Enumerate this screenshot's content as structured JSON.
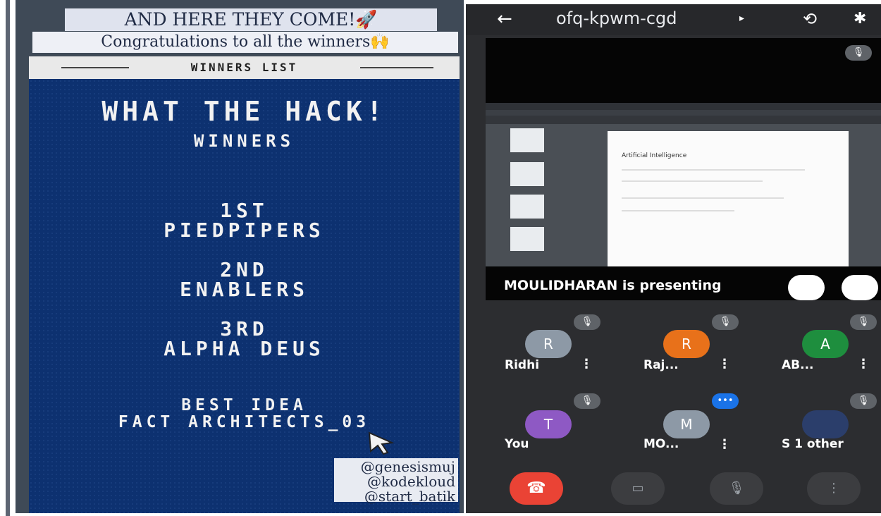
{
  "story": {
    "banner_title": "AND HERE THEY COME!🚀",
    "banner_sub": "Congratulations to all the winners🙌",
    "list_heading": "WINNERS LIST",
    "poster_title": "WHAT THE HACK!",
    "poster_sub": "WINNERS",
    "first_place": "1ST",
    "first_team": "PIEDPIPERS",
    "second_place": "2ND",
    "second_team": "ENABLERS",
    "third_place": "3RD",
    "third_team": "ALPHA DEUS",
    "best_idea": "BEST IDEA",
    "best_idea_team": "FACT ARCHITECTS_03",
    "handles": [
      "@genesismuj",
      "@kodekloud",
      "@start_batik"
    ]
  },
  "meet": {
    "meeting_code": "ofq-kpwm-cgd",
    "doc_title": "Artificial Intelligence",
    "presenting_label": "MOULIDHARAN is presenting",
    "participants": [
      {
        "initial": "R",
        "name": "Ridhi",
        "color": "#8d99a6"
      },
      {
        "initial": "R",
        "name": "Raj...",
        "color": "#e8711a"
      },
      {
        "initial": "A",
        "name": "AB...",
        "color": "#1e8e3e"
      },
      {
        "initial": "T",
        "name": "You",
        "color": "#8e59c4"
      },
      {
        "initial": "M",
        "name": "MO...",
        "color": "#8d99a6"
      },
      {
        "initial": "",
        "name": "S 1 other",
        "color": "#2b3e6b"
      }
    ],
    "icons": [
      "back-arrow-icon",
      "switch-camera-icon",
      "bluetooth-icon",
      "mic-off-icon",
      "end-call-icon",
      "camera-off-icon",
      "more-icon"
    ],
    "end_call_color": "#ea4335"
  }
}
